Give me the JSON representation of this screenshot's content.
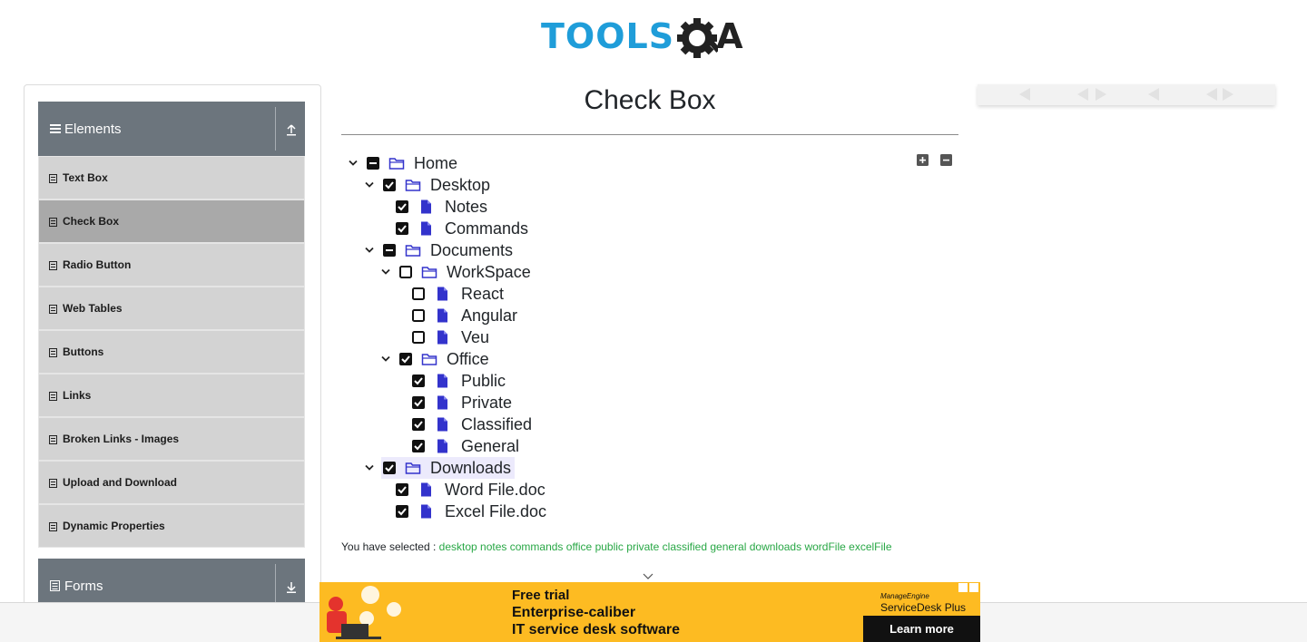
{
  "header": {
    "logo_tools": "TOOLS",
    "logo_qa_a": "A"
  },
  "sidebar": {
    "elements_group": {
      "label": "Elements"
    },
    "items": [
      {
        "label": "Text Box"
      },
      {
        "label": "Check Box"
      },
      {
        "label": "Radio Button"
      },
      {
        "label": "Web Tables"
      },
      {
        "label": "Buttons"
      },
      {
        "label": "Links"
      },
      {
        "label": "Broken Links - Images"
      },
      {
        "label": "Upload and Download"
      },
      {
        "label": "Dynamic Properties"
      }
    ],
    "forms_group": {
      "label": "Forms"
    }
  },
  "main": {
    "title": "Check Box",
    "tree": {
      "home": "Home",
      "desktop": "Desktop",
      "notes": "Notes",
      "commands": "Commands",
      "documents": "Documents",
      "workspace": "WorkSpace",
      "react": "React",
      "angular": "Angular",
      "veu": "Veu",
      "office": "Office",
      "public": "Public",
      "private": "Private",
      "classified": "Classified",
      "general": "General",
      "downloads": "Downloads",
      "wordfile": "Word File.doc",
      "excelfile": "Excel File.doc"
    },
    "result_prefix": "You have selected :",
    "selected": [
      "desktop",
      "notes",
      "commands",
      "office",
      "public",
      "private",
      "classified",
      "general",
      "downloads",
      "wordFile",
      "excelFile"
    ]
  },
  "banner": {
    "line1": "Free trial",
    "line2": "Enterprise-caliber",
    "line3": "IT service desk software",
    "brand_small": "ManageEngine",
    "brand": "ServiceDesk Plus",
    "button": "Learn more"
  },
  "colors": {
    "accent_blue": "#1f9dd9",
    "sidebar_header": "#6c757d",
    "menu_item": "#d3d3d3",
    "menu_item_active": "#a9a9a9",
    "selected_text": "#28a745",
    "file_icon": "#3333cc",
    "banner_bg": "#fdbb22"
  },
  "icons": {
    "menu": "hamburger-icon",
    "collapse": "arrow-up-icon",
    "expand": "arrow-down-icon",
    "folder": "folder-icon",
    "file": "file-icon",
    "expand_all": "plus-square-icon",
    "collapse_all": "minus-square-icon"
  }
}
